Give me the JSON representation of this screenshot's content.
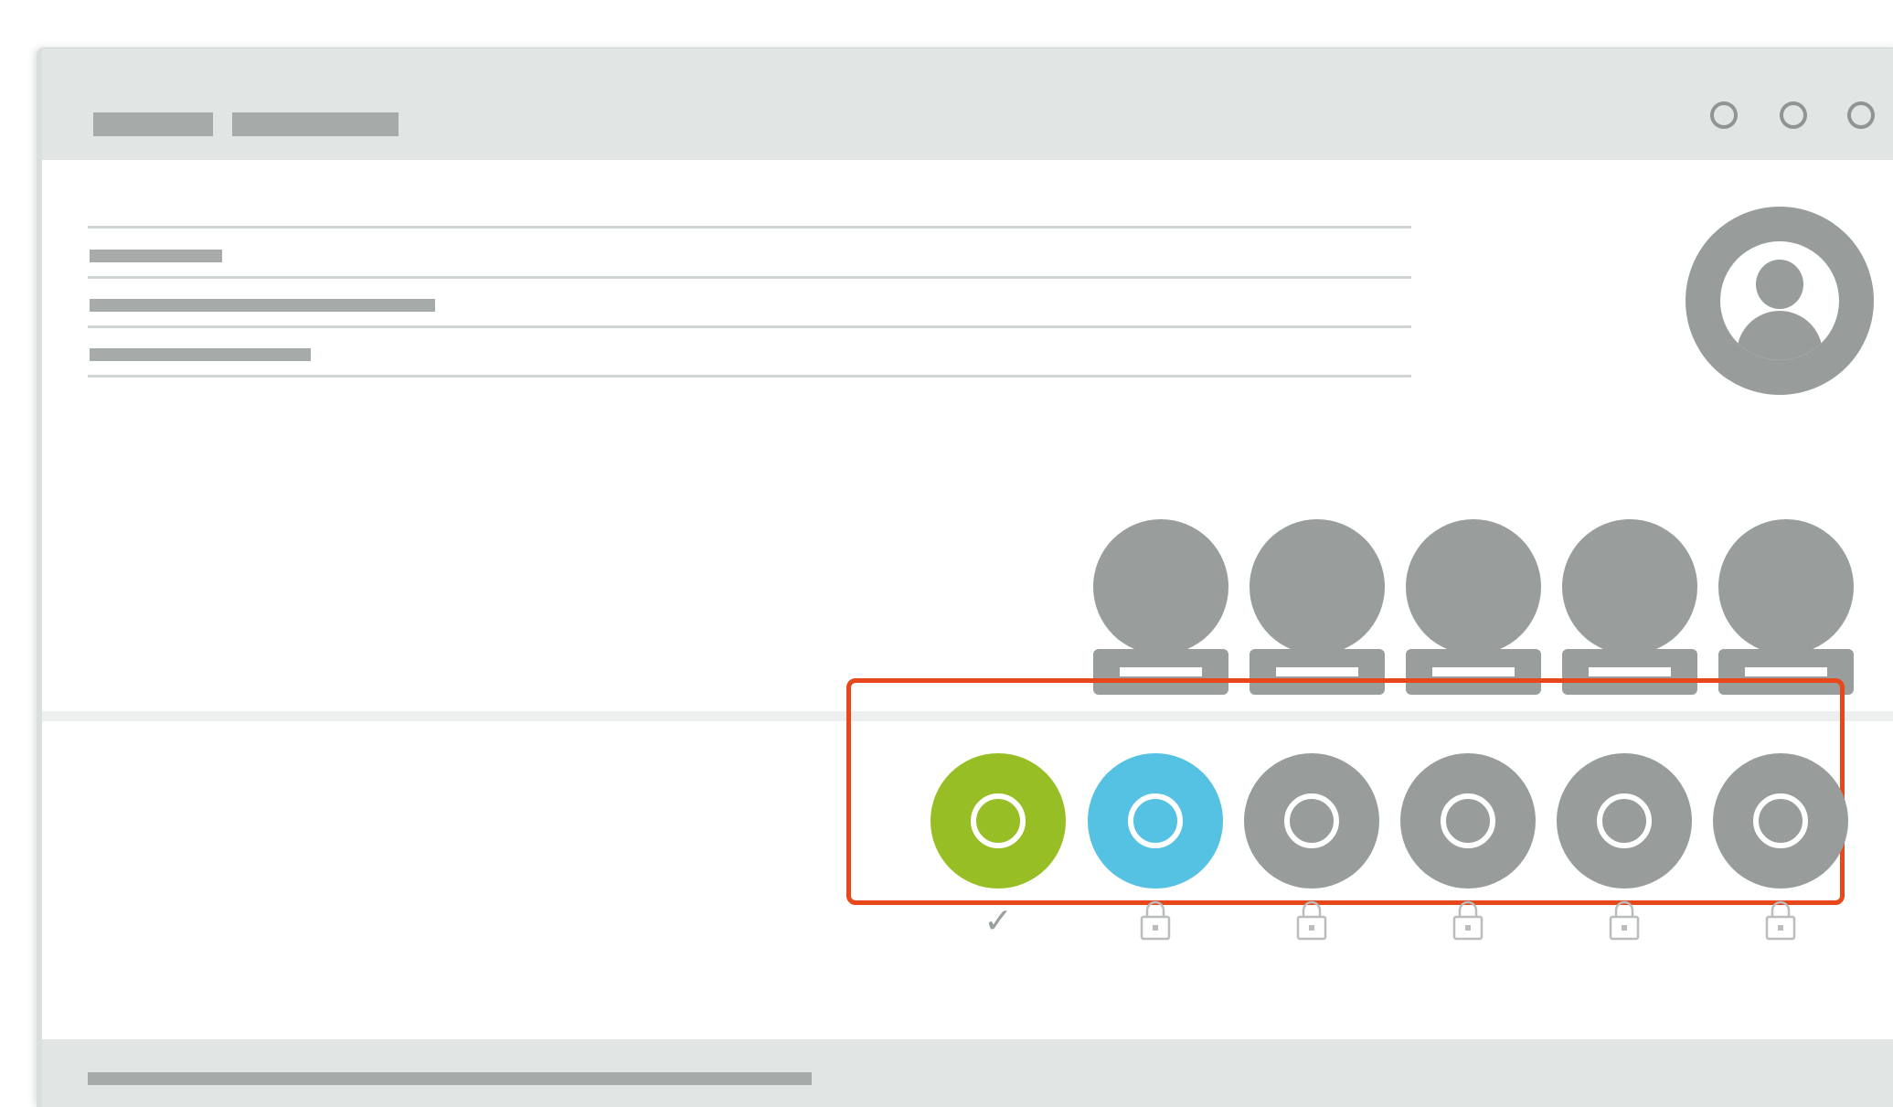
{
  "window": {
    "tabs": [
      "",
      ""
    ],
    "controls": [
      "window-control",
      "window-control",
      "window-control"
    ]
  },
  "profile": {
    "avatar_icon": "user-avatar-icon"
  },
  "badges": {
    "count": 5,
    "icon": "badge-icon"
  },
  "levels": {
    "items": [
      {
        "state": "completed",
        "color": "#97bf25",
        "status_icon": "check-icon",
        "status_text": "✓"
      },
      {
        "state": "unlocked",
        "color": "#55c2e3",
        "status_icon": "lock-icon",
        "status_text": ""
      },
      {
        "state": "locked",
        "color": "#989d9c",
        "status_icon": "lock-icon",
        "status_text": ""
      },
      {
        "state": "locked",
        "color": "#989d9c",
        "status_icon": "lock-icon",
        "status_text": ""
      },
      {
        "state": "locked",
        "color": "#989d9c",
        "status_icon": "lock-icon",
        "status_text": ""
      },
      {
        "state": "locked",
        "color": "#989d9c",
        "status_icon": "lock-icon",
        "status_text": ""
      }
    ],
    "highlight_color": "#e8471b"
  },
  "colors": {
    "chrome": "#e1e5e4",
    "placeholder": "#a6abaa",
    "gray_icon": "#989d9c",
    "complete": "#97bf25",
    "active": "#55c2e3"
  }
}
